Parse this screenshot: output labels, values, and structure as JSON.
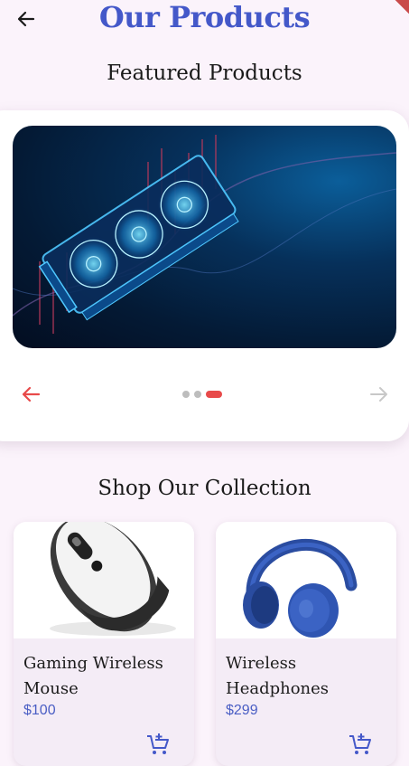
{
  "header": {
    "title": "Our Products",
    "back_icon": "arrow-left-icon"
  },
  "featured": {
    "title": "Featured Products",
    "slide_count": 3,
    "active_slide": 3,
    "prev_icon": "arrow-left-icon",
    "next_icon": "arrow-right-icon",
    "accent_color": "#e84a4a"
  },
  "collection": {
    "title": "Shop Our Collection",
    "products": [
      {
        "name": "Gaming Wireless Mouse",
        "price": "$100",
        "image": "mouse-image",
        "cart_icon": "add-shopping-cart-icon"
      },
      {
        "name": "Wireless Headphones",
        "price": "$299",
        "image": "headphones-image",
        "cart_icon": "add-shopping-cart-icon"
      }
    ]
  },
  "colors": {
    "background": "#fbf3fb",
    "title": "#4458c9",
    "price": "#4a5ec4",
    "cart": "#4458c9"
  }
}
